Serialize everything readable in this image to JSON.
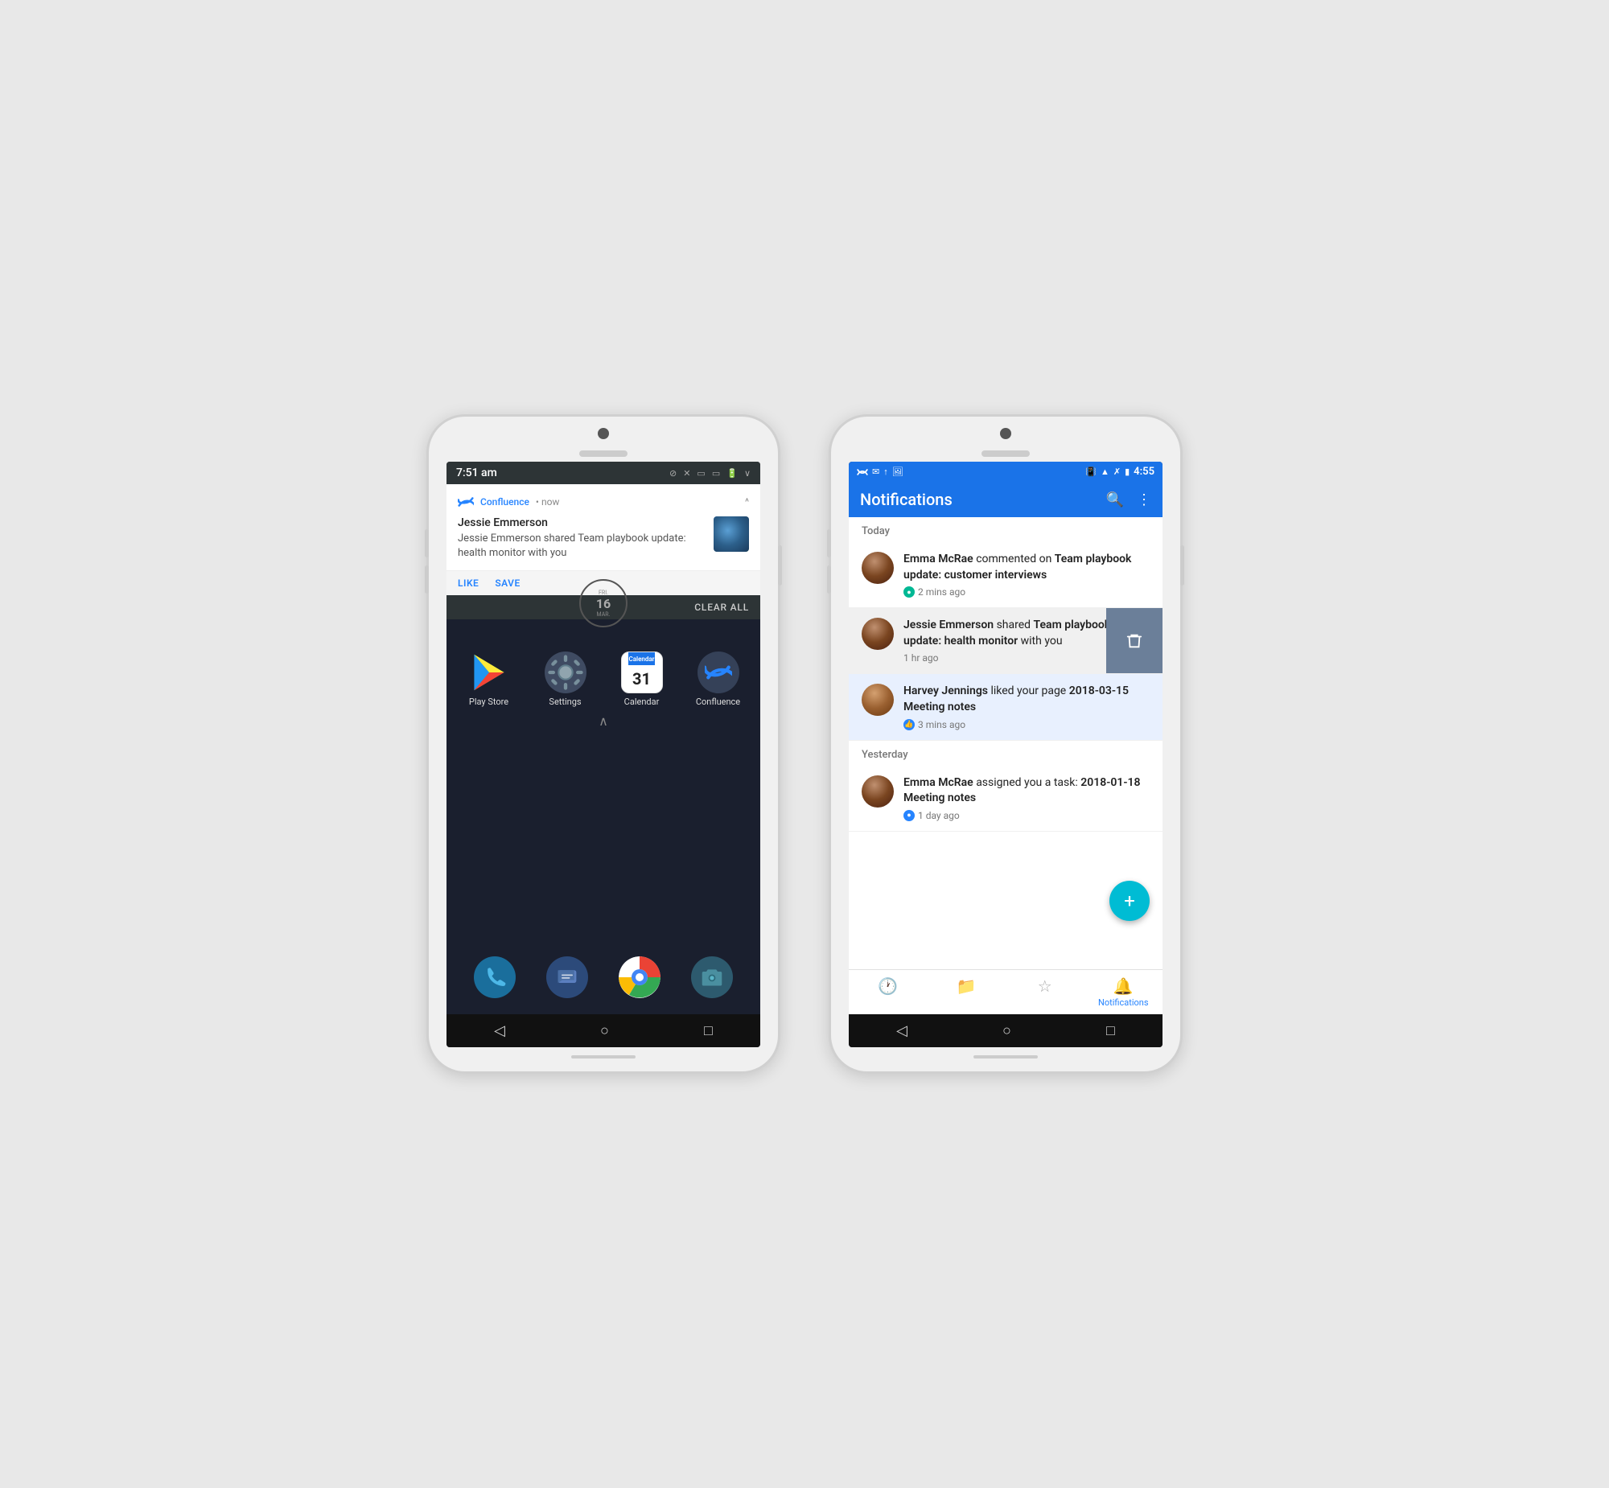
{
  "left_phone": {
    "status_bar": {
      "time": "7:51 am",
      "icons": [
        "wifi-off",
        "no-signal-1",
        "no-signal-2",
        "no-signal-3",
        "battery",
        "expand"
      ]
    },
    "notification": {
      "app_name": "Confluence",
      "time": "now",
      "expand_icon": "^",
      "user_name": "Jessie Emmerson",
      "description": "Jessie Emmerson shared Team playbook update: health monitor with you",
      "action_like": "LIKE",
      "action_save": "SAVE"
    },
    "date_display": {
      "day_label": "FRI.",
      "day": "16",
      "month": "MAR."
    },
    "clear_all": "CLEAR ALL",
    "apps": [
      {
        "label": "Play Store",
        "icon": "play-store"
      },
      {
        "label": "Settings",
        "icon": "settings"
      },
      {
        "label": "Calendar",
        "icon": "calendar",
        "date": "31"
      },
      {
        "label": "Confluence",
        "icon": "confluence"
      }
    ],
    "dock_apps": [
      {
        "label": "",
        "icon": "phone"
      },
      {
        "label": "",
        "icon": "messages"
      },
      {
        "label": "",
        "icon": "chrome"
      },
      {
        "label": "",
        "icon": "camera"
      }
    ],
    "nav": {
      "back": "◁",
      "home": "○",
      "recents": "□"
    }
  },
  "right_phone": {
    "status_bar": {
      "icons_left": [
        "confluence",
        "gmail",
        "upload",
        "image"
      ],
      "icons_right": [
        "vibrate",
        "wifi",
        "no-signal",
        "battery"
      ],
      "time": "4:55"
    },
    "app_bar": {
      "title": "Notifications",
      "search_icon": "search",
      "more_icon": "more-vertical"
    },
    "sections": [
      {
        "header": "Today",
        "items": [
          {
            "user": "Emma McRae",
            "action": "commented on",
            "page": "Team playbook update: customer interviews",
            "time": "2 mins ago",
            "time_icon": "green-dot",
            "avatar_class": "avatar-emma"
          },
          {
            "user": "Jessie Emmerson",
            "action": "shared",
            "page": "Team playbook update: health monitor",
            "suffix": "with you",
            "time": "1 hr ago",
            "time_icon": "none",
            "avatar_class": "avatar-jessie",
            "swipe_visible": true
          },
          {
            "user": "Harvey Jennings",
            "action": "liked your page",
            "page": "2018-03-15 Meeting notes",
            "time": "3 mins ago",
            "time_icon": "blue-dot",
            "avatar_class": "avatar-harvey"
          }
        ]
      },
      {
        "header": "Yesterday",
        "items": [
          {
            "user": "Emma McRae",
            "action": "assigned you a task:",
            "page": "2018-01-18 Meeting notes",
            "time": "1 day ago",
            "time_icon": "blue-dot",
            "avatar_class": "avatar-emma2"
          }
        ]
      }
    ],
    "fab": "+",
    "bottom_tabs": [
      {
        "icon": "clock",
        "label": "",
        "active": false
      },
      {
        "icon": "folder",
        "label": "",
        "active": false
      },
      {
        "icon": "star",
        "label": "",
        "active": false
      },
      {
        "icon": "bell",
        "label": "Notifications",
        "active": true
      }
    ],
    "nav": {
      "back": "◁",
      "home": "○",
      "recents": "□"
    }
  }
}
